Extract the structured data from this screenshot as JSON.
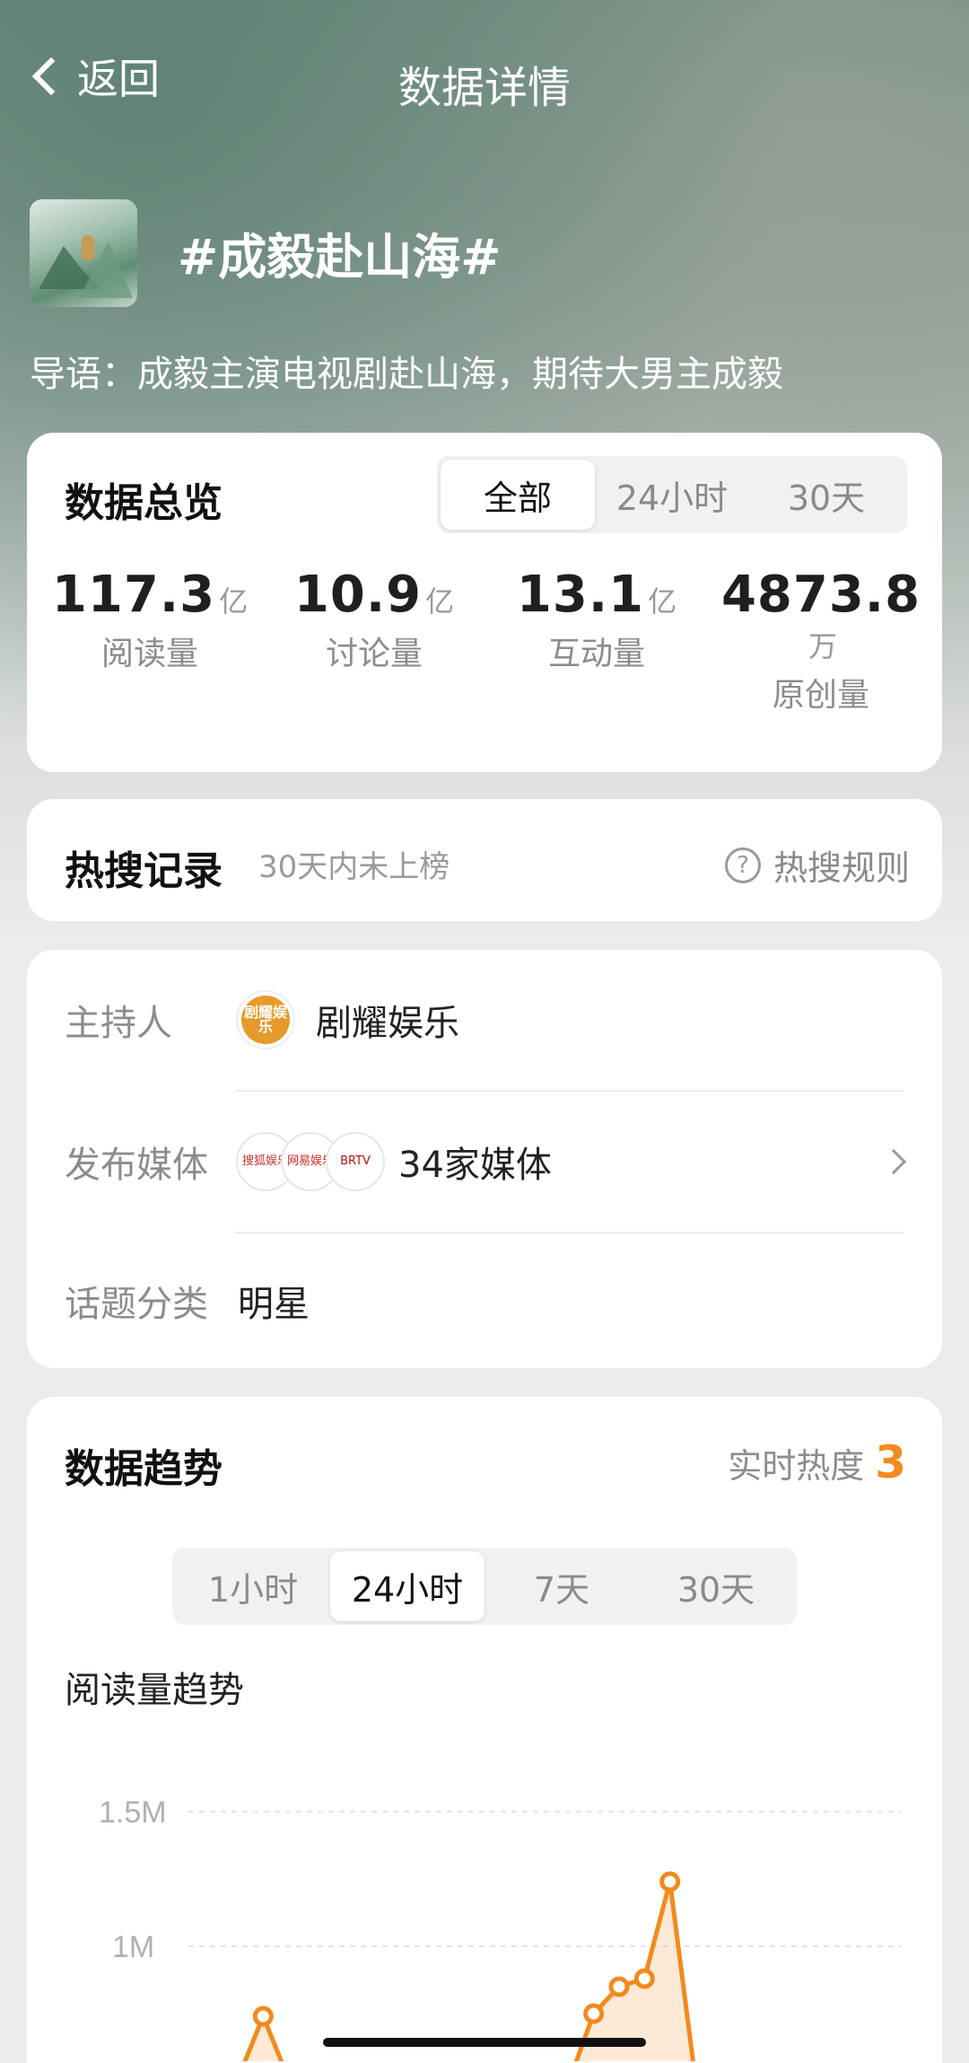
{
  "nav": {
    "back_label": "返回",
    "title": "数据详情"
  },
  "topic": {
    "title": "#成毅赴山海#",
    "guide": "导语：成毅主演电视剧赴山海，期待大男主成毅"
  },
  "overview": {
    "title": "数据总览",
    "tabs": [
      "全部",
      "24小时",
      "30天"
    ],
    "active_tab": "全部",
    "stats": [
      {
        "value": "117.3",
        "unit": "亿",
        "label": "阅读量"
      },
      {
        "value": "10.9",
        "unit": "亿",
        "label": "讨论量"
      },
      {
        "value": "13.1",
        "unit": "亿",
        "label": "互动量"
      },
      {
        "value": "4873.8",
        "unit": "万",
        "label": "原创量"
      }
    ]
  },
  "hot_search": {
    "title": "热搜记录",
    "subtitle": "30天内未上榜",
    "rules_label": "热搜规则",
    "rules_icon": "question-icon"
  },
  "info": {
    "host_label": "主持人",
    "host_name": "剧耀娱乐",
    "host_avatar_text": "剧耀娱乐",
    "media_label": "发布媒体",
    "media_count": "34家媒体",
    "media_avatars": [
      "搜狐娱乐",
      "网易娱乐",
      "BRTV"
    ],
    "category_label": "话题分类",
    "category_value": "明星"
  },
  "trend": {
    "title": "数据趋势",
    "heat_label": "实时热度",
    "heat_value": "3",
    "heat_color": "#f28a1e",
    "tabs": [
      "1小时",
      "24小时",
      "7天",
      "30天"
    ],
    "active_tab": "24小时",
    "chart_title": "阅读量趋势"
  },
  "chart_data": {
    "type": "area",
    "title": "阅读量趋势",
    "yticks": [
      "1.5M",
      "1M"
    ],
    "ylim": [
      0,
      1500000
    ],
    "grid": true,
    "color": "#f28a1e",
    "points": [
      {
        "x": 0,
        "y": 0
      },
      {
        "x": 1,
        "y": 0
      },
      {
        "x": 2,
        "y": 0
      },
      {
        "x": 3,
        "y": 0
      },
      {
        "x": 4,
        "y": 740000
      },
      {
        "x": 5,
        "y": 0
      },
      {
        "x": 6,
        "y": 0
      },
      {
        "x": 7,
        "y": 0
      },
      {
        "x": 8,
        "y": 0
      },
      {
        "x": 9,
        "y": 0
      },
      {
        "x": 10,
        "y": 0
      },
      {
        "x": 11,
        "y": 0
      },
      {
        "x": 12,
        "y": 0
      },
      {
        "x": 13,
        "y": 0
      },
      {
        "x": 14,
        "y": 0
      },
      {
        "x": 15,
        "y": 0
      },
      {
        "x": 16,
        "y": 490000
      },
      {
        "x": 17,
        "y": 750000
      },
      {
        "x": 18,
        "y": 850000
      },
      {
        "x": 19,
        "y": 880000
      },
      {
        "x": 20,
        "y": 1240000
      },
      {
        "x": 21,
        "y": 0
      }
    ]
  }
}
